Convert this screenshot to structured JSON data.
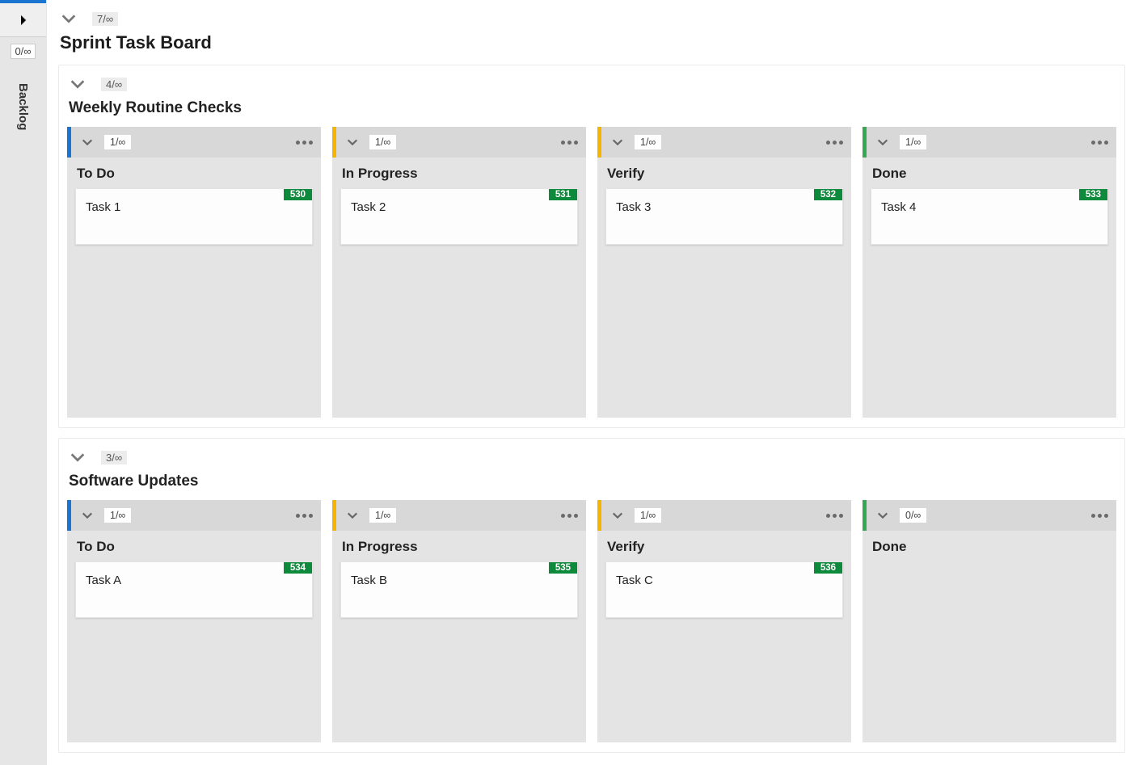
{
  "backlog": {
    "count": "0/∞",
    "label": "Backlog"
  },
  "board": {
    "count": "7/∞",
    "title": "Sprint Task Board",
    "swimlanes": [
      {
        "count": "4/∞",
        "title": "Weekly Routine Checks",
        "columns": [
          {
            "accent": "blue",
            "count": "1/∞",
            "title": "To Do",
            "cards": [
              {
                "badge": "530",
                "title": "Task 1"
              }
            ]
          },
          {
            "accent": "yellow",
            "count": "1/∞",
            "title": "In Progress",
            "cards": [
              {
                "badge": "531",
                "title": "Task 2"
              }
            ]
          },
          {
            "accent": "yellow",
            "count": "1/∞",
            "title": "Verify",
            "cards": [
              {
                "badge": "532",
                "title": "Task 3"
              }
            ]
          },
          {
            "accent": "green",
            "count": "1/∞",
            "title": "Done",
            "cards": [
              {
                "badge": "533",
                "title": "Task 4"
              }
            ]
          }
        ]
      },
      {
        "count": "3/∞",
        "title": "Software Updates",
        "columns": [
          {
            "accent": "blue",
            "count": "1/∞",
            "title": "To Do",
            "cards": [
              {
                "badge": "534",
                "title": "Task A"
              }
            ]
          },
          {
            "accent": "yellow",
            "count": "1/∞",
            "title": "In Progress",
            "cards": [
              {
                "badge": "535",
                "title": "Task B"
              }
            ]
          },
          {
            "accent": "yellow",
            "count": "1/∞",
            "title": "Verify",
            "cards": [
              {
                "badge": "536",
                "title": "Task C"
              }
            ]
          },
          {
            "accent": "green",
            "count": "0/∞",
            "title": "Done",
            "cards": []
          }
        ]
      }
    ]
  }
}
